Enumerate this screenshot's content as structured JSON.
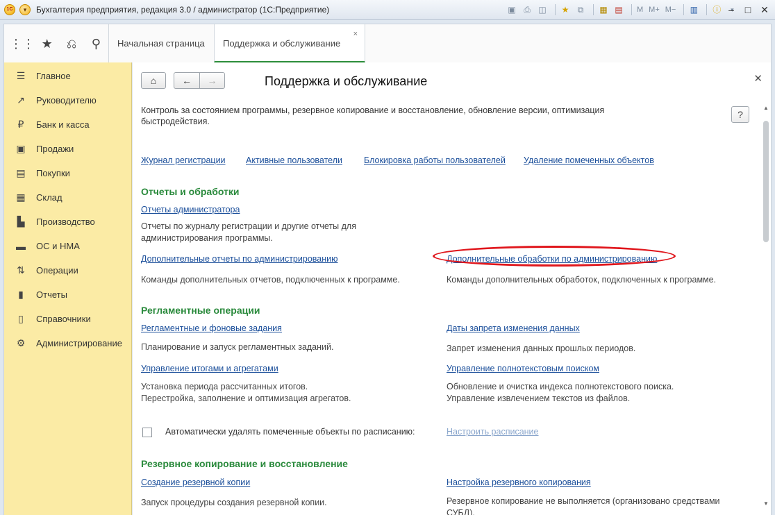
{
  "window": {
    "title": "Бухгалтерия предприятия, редакция 3.0 / администратор  (1С:Предприятие)",
    "logo_text": "1С",
    "toolbar_m": "M",
    "toolbar_mplus": "M+",
    "toolbar_mminus": "M−"
  },
  "tabs": [
    {
      "label": "Начальная страница"
    },
    {
      "label": "Поддержка и обслуживание",
      "active": true
    }
  ],
  "sidebar": {
    "items": [
      {
        "label": "Главное",
        "icon": "menu-icon"
      },
      {
        "label": "Руководителю",
        "icon": "trend-icon"
      },
      {
        "label": "Банк и касса",
        "icon": "ruble-icon"
      },
      {
        "label": "Продажи",
        "icon": "bag-icon"
      },
      {
        "label": "Покупки",
        "icon": "cart-icon"
      },
      {
        "label": "Склад",
        "icon": "warehouse-icon"
      },
      {
        "label": "Производство",
        "icon": "factory-icon"
      },
      {
        "label": "ОС и НМА",
        "icon": "truck-icon"
      },
      {
        "label": "Операции",
        "icon": "operations-icon"
      },
      {
        "label": "Отчеты",
        "icon": "bar-chart-icon"
      },
      {
        "label": "Справочники",
        "icon": "book-icon"
      },
      {
        "label": "Администрирование",
        "icon": "gear-icon"
      }
    ]
  },
  "page": {
    "title": "Поддержка и обслуживание",
    "help_label": "?",
    "description": "Контроль за состоянием программы, резервное копирование и восстановление, обновление версии, оптимизация быстродействия.",
    "top_links": [
      "Журнал регистрации",
      "Активные пользователи",
      "Блокировка работы пользователей",
      "Удаление помеченных объектов"
    ],
    "sections": {
      "reports": {
        "title": "Отчеты и обработки",
        "admin_reports_link": "Отчеты администратора",
        "admin_reports_desc": "Отчеты по журналу регистрации и другие отчеты для администрирования программы.",
        "add_reports_link": "Дополнительные отчеты по администрированию",
        "add_reports_desc": "Команды дополнительных отчетов, подключенных к программе.",
        "add_processing_link": "Дополнительные обработки по администрированию",
        "add_processing_desc": "Команды дополнительных обработок, подключенных к программе."
      },
      "routine": {
        "title": "Регламентные операции",
        "jobs_link": "Регламентные и фоновые задания",
        "jobs_desc": "Планирование и запуск регламентных заданий.",
        "dates_link": "Даты запрета изменения данных",
        "dates_desc": "Запрет изменения данных прошлых периодов.",
        "totals_link": "Управление итогами и агрегатами",
        "totals_desc": "Установка периода рассчитанных итогов. Перестройка, заполнение и оптимизация агрегатов.",
        "search_link": "Управление полнотекстовым поиском",
        "search_desc": "Обновление и очистка индекса полнотекстового поиска. Управление извлечением текстов из файлов.",
        "auto_delete_label": "Автоматически удалять помеченные объекты по расписанию:",
        "schedule_link": "Настроить расписание"
      },
      "backup": {
        "title": "Резервное копирование и восстановление",
        "create_link": "Создание резервной копии",
        "create_desc": "Запуск процедуры создания резервной копии.",
        "settings_link": "Настройка резервного копирования",
        "settings_desc": "Резервное копирование не выполняется (организовано средствами СУБД)."
      }
    }
  },
  "colors": {
    "sidebar_bg": "#fbeba5",
    "section_title": "#2a8a3c",
    "link": "#1a4e9a",
    "highlight": "#e0161c"
  }
}
